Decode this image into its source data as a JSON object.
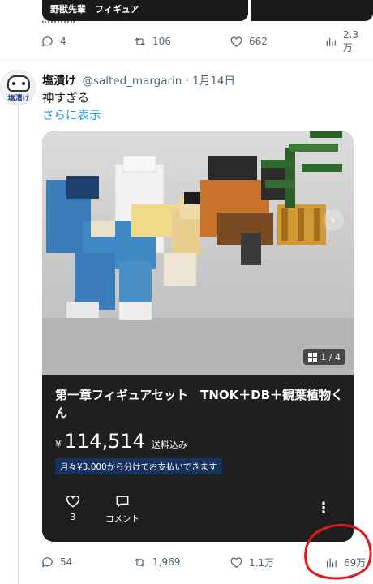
{
  "previous_tweet": {
    "card_text": "野獣先輩　フィギュア",
    "actions": {
      "replies": "4",
      "retweets": "106",
      "likes": "662",
      "views": "2.3万"
    }
  },
  "tweet": {
    "avatar_text": "塩漬け",
    "display_name": "塩漬け",
    "handle_date": "@salted_margarin · 1月14日",
    "text": "神すぎる",
    "show_more": "さらに表示",
    "card": {
      "page_indicator": "1 / 4",
      "title": "第一章フィギュアセット　TNOK＋DB＋観葉植物くん",
      "price_currency": "¥",
      "price": "114,514",
      "shipping_note": "送料込み",
      "installment": "月々¥3,000から分けてお支払いできます",
      "like_count": "3",
      "comment_label": "コメント"
    },
    "actions": {
      "replies": "54",
      "retweets": "1,969",
      "likes": "1.1万",
      "views": "69万"
    }
  },
  "colors": {
    "link": "#1d9bf0",
    "muted": "#536471",
    "annotation": "#e0191b",
    "card_bg": "#262626"
  },
  "icons": [
    "reply-icon",
    "retweet-icon",
    "like-icon",
    "views-icon",
    "grid-icon",
    "chevron-right-icon",
    "heart-icon",
    "comment-icon",
    "more-icon"
  ]
}
